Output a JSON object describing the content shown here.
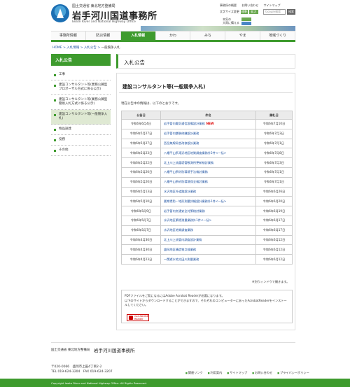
{
  "header": {
    "org_small": "国土交通省 東北地方整備局",
    "title": "岩手河川国道事務所",
    "subtitle": "Iwate River and National Highway Office",
    "util_links": [
      "事務所の概要",
      "お問い合わせ",
      "サイトマップ"
    ],
    "fontsize_label": "文字サイズ変更",
    "fontsize_buttons": [
      "標準",
      "拡大"
    ],
    "search_placeholder": "Google検索",
    "search_button": "検索",
    "mascot_text": "本気の\n大雨に備える"
  },
  "nav": {
    "items": [
      "事務所情報",
      "防災情報",
      "入札情報",
      "かわ",
      "みち",
      "やま",
      "地域づくり"
    ],
    "active_index": 2
  },
  "breadcrumb": {
    "items": [
      "HOME",
      "入札情報",
      "入札公告"
    ],
    "current": "一般競争入札"
  },
  "sidebar": {
    "heading": "入札公告",
    "items": [
      {
        "label": "工事",
        "active": false
      },
      {
        "label": "建設コンサルタント等(業務公募型プロポーザル方式に係る公示)",
        "active": false
      },
      {
        "label": "建設コンサルタント等(業務公募型簡易入札方式に係る公示)",
        "active": false
      },
      {
        "label": "建設コンサルタント等(一般競争入札)",
        "active": true
      },
      {
        "label": "物品調達",
        "active": false
      },
      {
        "label": "役務",
        "active": false
      },
      {
        "label": "その他",
        "active": false
      }
    ]
  },
  "main": {
    "page_title": "入札公告",
    "section_title": "建設コンサルタント等(一般競争入札)",
    "intro": "現在公告中の情報は、以下のとおりです。",
    "table": {
      "headers": [
        "公告日",
        "件名",
        "開札日"
      ],
      "rows": [
        {
          "date": "令和6年6月4日",
          "name": "岩手管内電気通信設備設計業務",
          "new": "NEW",
          "opening": "令和6年7月10日"
        },
        {
          "date": "令和6年5月27日",
          "name": "岩手管内舗装修繕設計業務",
          "new": "",
          "opening": "令和6年7月3日"
        },
        {
          "date": "令和6年5月27日",
          "name": "西岳無線局舎改修設計業務",
          "new": "",
          "opening": "令和6年7月1日"
        },
        {
          "date": "令和6年5月23日",
          "name": "八幡平山系滝沢地区地質調査業務外2件<一括>",
          "new": "",
          "opening": "令和6年7月8日"
        },
        {
          "date": "令和6年5月22日",
          "name": "北上川上流霞堤管観測所更新検討業務",
          "new": "",
          "opening": "令和6年7月3日"
        },
        {
          "date": "令和6年5月20日",
          "name": "八幡平山系砂防環境手法検討業務",
          "new": "",
          "opening": "令和6年7月1日"
        },
        {
          "date": "令和6年5月20日",
          "name": "八幡平山系砂防環境保全検討業務",
          "new": "",
          "opening": "令和6年7月1日"
        },
        {
          "date": "令和6年5月13日",
          "name": "水沢地区外道路設計業務",
          "new": "",
          "opening": "令和6年6月26日"
        },
        {
          "date": "令和6年5月10日",
          "name": "夏期堤防・地形測量詳細設計業務外1件<一括>",
          "new": "",
          "opening": "令和6年6月20日"
        },
        {
          "date": "令和6年5月9日",
          "name": "岩手管内交通安全対策検討業務",
          "new": "",
          "opening": "令和6年6月19日"
        },
        {
          "date": "令和6年5月7日",
          "name": "水沢地区築堤測量業務外1件<一括>",
          "new": "",
          "opening": "令和6年6月17日"
        },
        {
          "date": "令和6年5月7日",
          "name": "水沢地区地質調査業務",
          "new": "",
          "opening": "令和6年6月17日"
        },
        {
          "date": "令和6年4月30日",
          "name": "北上川上流管内調査設計業務",
          "new": "",
          "opening": "令和6年6月12日"
        },
        {
          "date": "令和6年4月30日",
          "name": "盛岡地区構造物点検業務",
          "new": "",
          "opening": "令和6年6月12日"
        },
        {
          "date": "令和6年4月23日",
          "name": "一関遊水地太田川測量業務",
          "new": "",
          "opening": "令和6年6月12日"
        }
      ]
    },
    "window_note": "※別ウィンドウで開きます。",
    "pdf_note_1": "PDFファイルをご覧になるにはAdobe Acrobat Readerが必要になります。",
    "pdf_note_2": "以下のサイトからダウンロードすることができますので、それぞれのコンピューターにあったAcrobatReaderをインストールしてください。",
    "reader_badge": "Get ADOBE Reader"
  },
  "footer": {
    "org_small": "国土交通省 東北地方整備局",
    "org": "岩手河川国道事務所",
    "postal": "〒020-0066",
    "address": "盛岡市上田4丁目2-2",
    "tel": "TEL 019-624-3204",
    "fax": "FAX 019-624-3207",
    "links": [
      "関連リンク",
      "利用案内",
      "サイトマップ",
      "お問い合わせ",
      "プライバシーポリシー"
    ],
    "copyright": "Copyright Iwate River and National Highway Office. All Rights Reserved."
  },
  "colors": {
    "accent": "#3e9b2e",
    "link": "#1a4fa0",
    "new": "#dd0000"
  }
}
